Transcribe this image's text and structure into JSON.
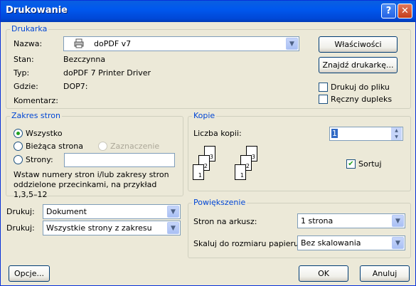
{
  "window": {
    "title": "Drukowanie"
  },
  "printer": {
    "group_label": "Drukarka",
    "name_label": "Nazwa:",
    "name_value": "doPDF v7",
    "status_label": "Stan:",
    "status_value": "Bezczynna",
    "type_label": "Typ:",
    "type_value": "doPDF 7 Printer Driver",
    "where_label": "Gdzie:",
    "where_value": "DOP7:",
    "comment_label": "Komentarz:",
    "properties_button": "Właściwości",
    "find_button": "Znajdź drukarkę...",
    "print_to_file": {
      "label": "Drukuj do pliku",
      "checked": false
    },
    "manual_duplex": {
      "label": "Ręczny dupleks",
      "checked": false
    }
  },
  "page_range": {
    "group_label": "Zakres stron",
    "all_label": "Wszystko",
    "current_label": "Bieżąca strona",
    "selection_label": "Zaznaczenie",
    "pages_label": "Strony:",
    "pages_value": "",
    "hint": "Wstaw numery stron i/lub zakresy stron oddzielone przecinkami, na przykład 1,3,5–12",
    "selected": "all"
  },
  "copies": {
    "group_label": "Kopie",
    "count_label": "Liczba kopii:",
    "count_value": "1",
    "collate_label": "Sortuj",
    "collate_checked": true,
    "page_numbers": [
      "3",
      "2",
      "1",
      "3",
      "2",
      "1"
    ]
  },
  "print_what": {
    "label": "Drukuj:",
    "value": "Dokument"
  },
  "print_pages": {
    "label": "Drukuj:",
    "value": "Wszystkie strony z zakresu"
  },
  "zoom": {
    "group_label": "Powiększenie",
    "pages_per_sheet_label": "Stron na arkusz:",
    "pages_per_sheet_value": "1 strona",
    "scale_label": "Skaluj do rozmiaru papieru:",
    "scale_value": "Bez skalowania"
  },
  "buttons": {
    "options": "Opcje...",
    "ok": "OK",
    "cancel": "Anuluj"
  },
  "icons": {
    "help": "help-icon",
    "close": "close-icon",
    "printer": "printer-icon"
  },
  "colors": {
    "titlebar": "#0058ee",
    "dialog_bg": "#ece9d8",
    "group_title": "#0046d5"
  }
}
